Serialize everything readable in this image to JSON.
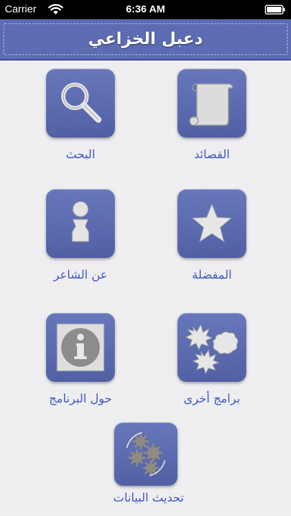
{
  "status_bar": {
    "carrier": "Carrier",
    "time": "6:36 AM"
  },
  "nav": {
    "title": "دعبل الخزاعي"
  },
  "tiles": [
    {
      "label": "القصائد",
      "icon": "scroll-icon"
    },
    {
      "label": "البحث",
      "icon": "magnifier-icon"
    },
    {
      "label": "المفضلة",
      "icon": "star-icon"
    },
    {
      "label": "عن الشاعر",
      "icon": "person-icon"
    },
    {
      "label": "برامج أخرى",
      "icon": "burst-icon"
    },
    {
      "label": "حول البرنامج",
      "icon": "info-icon"
    },
    {
      "label": "تحديث البيانات",
      "icon": "gears-icon"
    }
  ],
  "colors": {
    "tile_blue": "#5a6cb5",
    "label_blue": "#3f58c8",
    "background": "#f1f1f3"
  }
}
